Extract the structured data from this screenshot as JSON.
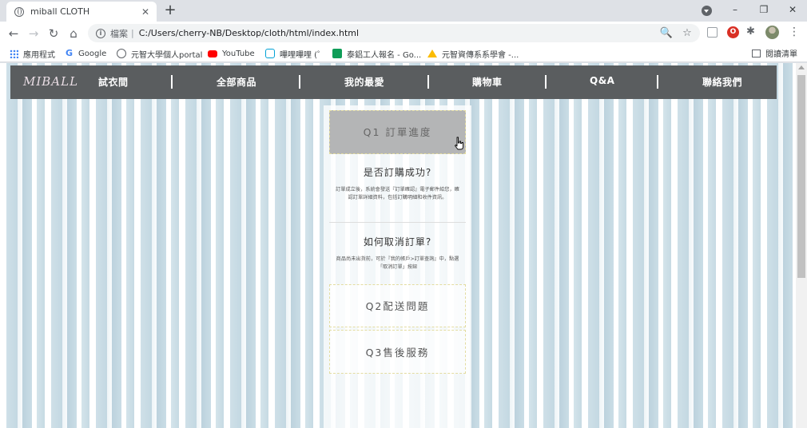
{
  "browser": {
    "tab": {
      "title": "miball CLOTH",
      "close": "✕"
    },
    "new_tab": "+",
    "window_controls": [
      "–",
      "❐",
      "✕"
    ],
    "nav": {
      "back": "←",
      "forward": "→",
      "reload": "↻",
      "home": "⌂"
    },
    "address": {
      "scheme_label": "檔案",
      "separator": "|",
      "url": "C:/Users/cherry-NB/Desktop/cloth/html/index.html"
    },
    "address_icons": {
      "zoom": "🔍",
      "star": "☆"
    },
    "extensions": {
      "red_badge": "O",
      "puzzle": "✱",
      "menu": "⋮"
    },
    "bookmarks": [
      {
        "label": "應用程式",
        "icon": "apps-grid"
      },
      {
        "label": "Google",
        "icon": "google-g",
        "color": "#4285f4"
      },
      {
        "label": "元智大學個人portal",
        "icon": "globe",
        "color": "#5f6368"
      },
      {
        "label": "YouTube",
        "icon": "youtube",
        "color": "#ff0000"
      },
      {
        "label": "嗶哩嗶哩 (゜",
        "icon": "bilibili-tv",
        "color": "#00a1d6"
      },
      {
        "label": "泰鋁工人報名 - Go...",
        "icon": "sheets-plus",
        "color": "#0f9d58"
      },
      {
        "label": "元智資傳系系學會 -...",
        "icon": "drive-triangle",
        "color": "#fbbc04"
      }
    ],
    "reading_list": "閱讀清單"
  },
  "site": {
    "logo": "MIBALL",
    "nav": [
      "試衣間",
      "全部商品",
      "我的最愛",
      "購物車",
      "Q&A",
      "聯絡我們"
    ],
    "nav_separator": "|",
    "colors": {
      "nav_bg": "#5a5d5f",
      "q1_bg": "#b4b5b6",
      "border": "#e3dca0"
    }
  },
  "faq": {
    "q1": "Q1 訂單進度",
    "q1_items": [
      {
        "title": "是否訂購成功?",
        "text": "訂單成立後，系統會發送『訂單確認』電子郵件給您，確認訂單詳細資料，包括訂購明細和收件資訊。"
      },
      {
        "title": "如何取消訂單?",
        "text": "商品尚未出貨前，可於『我的帳戶>訂單查詢』中，點選「取消訂單」按鈕"
      }
    ],
    "q2": "Q2配送問題",
    "q3": "Q3售後服務"
  }
}
